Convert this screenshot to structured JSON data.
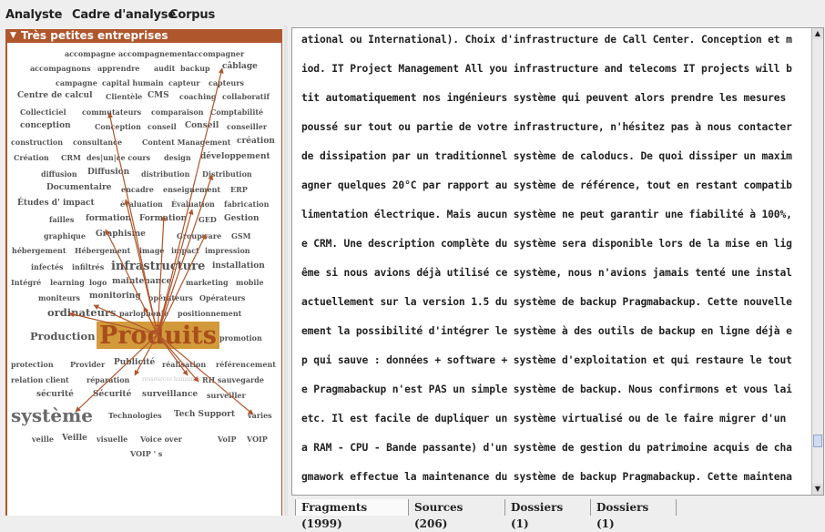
{
  "menu": {
    "items": [
      "Analyste",
      "Cadre d'analyse",
      "Corpus"
    ]
  },
  "left_panel": {
    "title": "Très petites entreprises",
    "cloud_words": [
      "accompagne",
      "accompagnement",
      "accompagner",
      "accompagnons",
      "apprendre",
      "audit",
      "backup",
      "câblage",
      "campagne",
      "capital humain",
      "capteur",
      "capteurs",
      "Centre de calcul",
      "Clientèle",
      "CMS",
      "coaching",
      "collaboratif",
      "Collecticiel",
      "commutateurs",
      "comparaison",
      "Comptabilité",
      "conception",
      "Conception",
      "conseil",
      "Conseil",
      "conseiller",
      "construction",
      "consultance",
      "Content Management",
      "création",
      "Création",
      "CRM",
      "des|un|ce cours",
      "design",
      "développement",
      "diffusion",
      "Diffusion",
      "distribution",
      "Distribution",
      "Documentaire",
      "encadre",
      "enseignement",
      "ERP",
      "Études d' impact",
      "évaluation",
      "Évaluation",
      "fabrication",
      "failles",
      "formation",
      "Formation",
      "GED",
      "Gestion",
      "graphique",
      "Graphisme",
      "Groupware",
      "GSM",
      "hébergement",
      "Hébergement",
      "image",
      "impact",
      "impression",
      "infectés",
      "infiltrés",
      "infrastructure",
      "installation",
      "Intégré",
      "learning",
      "logo",
      "maintenance",
      "marketing",
      "mobile",
      "moniteurs",
      "monitoring",
      "opérateurs",
      "Opérateurs",
      "ordinateurs",
      "parlophonie",
      "positionnement",
      "Production",
      "Produits",
      "promotion",
      "protection",
      "Provider",
      "Publicité",
      "réalisation",
      "référencement",
      "relation client",
      "réparation",
      "ressources humaines",
      "RH",
      "sauvegarde",
      "sécurité",
      "Sécurité",
      "surveillance",
      "surveiller",
      "système",
      "Technologies",
      "Tech Support",
      "varies",
      "veille",
      "Veille",
      "visuelle",
      "Voice over",
      "VoIP",
      "VOIP",
      "VOIP ' s"
    ]
  },
  "text_lines": [
    "ational ou International). Choix d'infrastructure de Call Center. Conception et m",
    "iod. IT Project Management All you infrastructure and telecoms IT projects will b",
    "tit automatiquement nos ingénieurs système qui peuvent alors prendre les mesures",
    "poussé sur tout ou partie de votre infrastructure, n'hésitez pas à nous contacter",
    "de dissipation par un traditionnel système de caloducs. De quoi dissiper un maxim",
    "agner quelques 20°C par rapport au système de référence, tout en restant compatib",
    "limentation électrique. Mais aucun système ne peut garantir une fiabilité à 100%,",
    "e CRM. Une description complète du système sera disponible lors de la mise en lig",
    "ême si nous avions déjà utilisé ce système, nous n'avions jamais tenté une instal",
    "actuellement sur la version 1.5 du système de backup Pragmabackup. Cette nouvelle",
    "ement la possibilité d'intégrer le système à des outils de backup en ligne déjà e",
    "p qui sauve : données + software + système d'exploitation et qui restaure le tout",
    "e Pragmabackup n'est PAS un simple système de backup. Nous confirmons et vous lai",
    "etc. Il est facile de dupliquer un système virtualisé ou de le faire migrer d'un",
    "a RAM - CPU - Bande passante) d'un système de gestion du patrimoine acquis de cha",
    "gmawork effectue la maintenance du système de backup Pragmabackup. Cette maintena"
  ],
  "tabs": [
    "Fragments (1999)",
    "Sources (206)",
    "Dossiers (1)",
    "Dossiers (1)"
  ],
  "colors": {
    "accent": "#b0562c",
    "highlight": "#d39a3c",
    "highlight_text": "#a94e1a",
    "arrow": "#b0562c"
  },
  "icons": {
    "collapse": "triangle-down-icon",
    "scroll_up": "arrow-up-icon",
    "scroll_down": "arrow-down-icon"
  }
}
